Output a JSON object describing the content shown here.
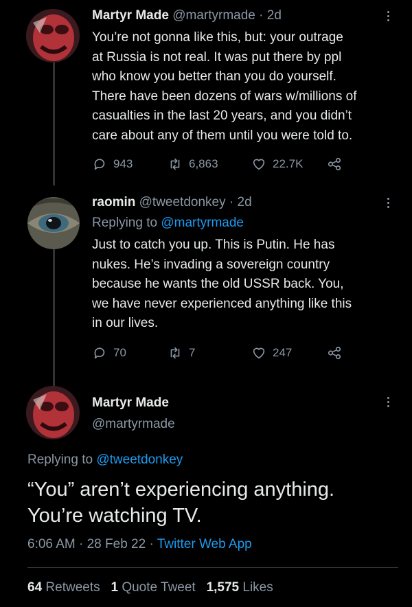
{
  "tweet1": {
    "display_name": "Martyr Made",
    "handle": "@martyrmade",
    "time": "2d",
    "lines": [
      "You’re not gonna like this, but: your outrage",
      "at Russia is not real. It was put there by ppl",
      "who know you better than you do yourself.",
      "There have been dozens of wars w/millions of",
      "casualties in the last 20 years, and you didn’t",
      "care about any of them until you were told to."
    ],
    "replies": "943",
    "retweets": "6,863",
    "likes": "22.7K"
  },
  "tweet2": {
    "display_name": "raomin",
    "handle": "@tweetdonkey",
    "time": "2d",
    "replying_label": "Replying to",
    "replying_to": "@martyrmade",
    "lines": [
      "Just to catch you up. This is Putin. He has",
      "nukes. He’s invading a sovereign country",
      "because he wants the old USSR back. You,",
      "we have never experienced anything like this",
      "in our lives."
    ],
    "replies": "70",
    "retweets": "7",
    "likes": "247"
  },
  "main_tweet": {
    "display_name": "Martyr Made",
    "handle": "@martyrmade",
    "replying_label": "Replying to",
    "replying_to": "@tweetdonkey",
    "text_line1": "“You” aren’t experiencing anything.",
    "text_line2": "You’re watching TV.",
    "time": "6:06 AM",
    "date": "28 Feb 22",
    "source": "Twitter Web App",
    "retweet_count": "64",
    "retweet_label": "Retweets",
    "quote_count": "1",
    "quote_label": "Quote Tweet",
    "like_count": "1,575",
    "like_label": "Likes"
  },
  "separator": "·",
  "icons": [
    "reply-icon",
    "retweet-icon",
    "like-icon",
    "share-icon",
    "more-icon"
  ],
  "colors": {
    "background": "#000000",
    "text": "#e7e9ea",
    "muted": "#8b98a5",
    "link": "#1d9bf0"
  }
}
